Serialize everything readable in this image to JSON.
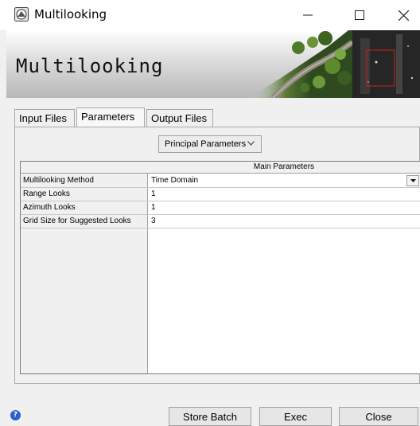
{
  "window": {
    "title": "Multilooking"
  },
  "banner": {
    "title": "Multilooking"
  },
  "tabs": [
    {
      "label": "Input Files"
    },
    {
      "label": "Parameters"
    },
    {
      "label": "Output Files"
    }
  ],
  "active_tab": "Parameters",
  "section_select": {
    "value": "Principal Parameters"
  },
  "table": {
    "header": "Main Parameters",
    "rows": [
      {
        "label": "Multilooking Method",
        "value": "Time Domain",
        "type": "dropdown"
      },
      {
        "label": "Range Looks",
        "value": "1"
      },
      {
        "label": "Azimuth Looks",
        "value": "1"
      },
      {
        "label": "Grid Size for Suggested Looks",
        "value": "3"
      }
    ]
  },
  "footer": {
    "help_glyph": "?",
    "store_batch_label": "Store Batch",
    "exec_label": "Exec",
    "close_label": "Close"
  },
  "icons": {
    "app": "app-icon",
    "minimize": "minimize-icon",
    "maximize": "maximize-icon",
    "close": "close-icon",
    "chevron": "chevron-down-icon",
    "combo_arrow": "dropdown-arrow-icon",
    "help": "help-icon"
  },
  "colors": {
    "help_icon": "#2b61c8",
    "highlight_box": "#d42020"
  }
}
